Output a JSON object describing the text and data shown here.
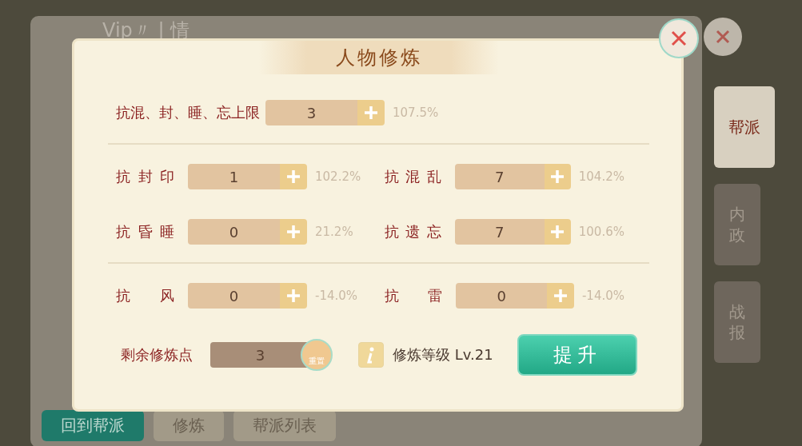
{
  "background": {
    "header": "Vip〃 | 情",
    "side_tabs": [
      {
        "label": "帮派",
        "selected": true
      },
      {
        "label": "内政",
        "selected": false
      },
      {
        "label": "战报",
        "selected": false
      }
    ],
    "bottom_buttons": [
      {
        "label": "回到帮派",
        "selected": true
      },
      {
        "label": "修炼",
        "selected": false
      },
      {
        "label": "帮派列表",
        "selected": false
      }
    ]
  },
  "dialog": {
    "title": "人物修炼",
    "limit": {
      "label": "抗混、封、睡、忘上限",
      "value": "3",
      "percent": "107.5%"
    },
    "groups": [
      [
        {
          "label": "抗封印",
          "value": "1",
          "percent": "102.2%"
        },
        {
          "label": "抗混乱",
          "value": "7",
          "percent": "104.2%"
        },
        {
          "label": "抗昏睡",
          "value": "0",
          "percent": "21.2%"
        },
        {
          "label": "抗遗忘",
          "value": "7",
          "percent": "100.6%"
        }
      ],
      [
        {
          "label": "抗 风",
          "value": "0",
          "percent": "-14.0%"
        },
        {
          "label": "抗 雷",
          "value": "0",
          "percent": "-14.0%"
        }
      ]
    ],
    "remaining": {
      "label": "剩余修炼点",
      "value": "3",
      "reset": "重置"
    },
    "level": "修炼等级 Lv.21",
    "upgrade": "提升"
  }
}
